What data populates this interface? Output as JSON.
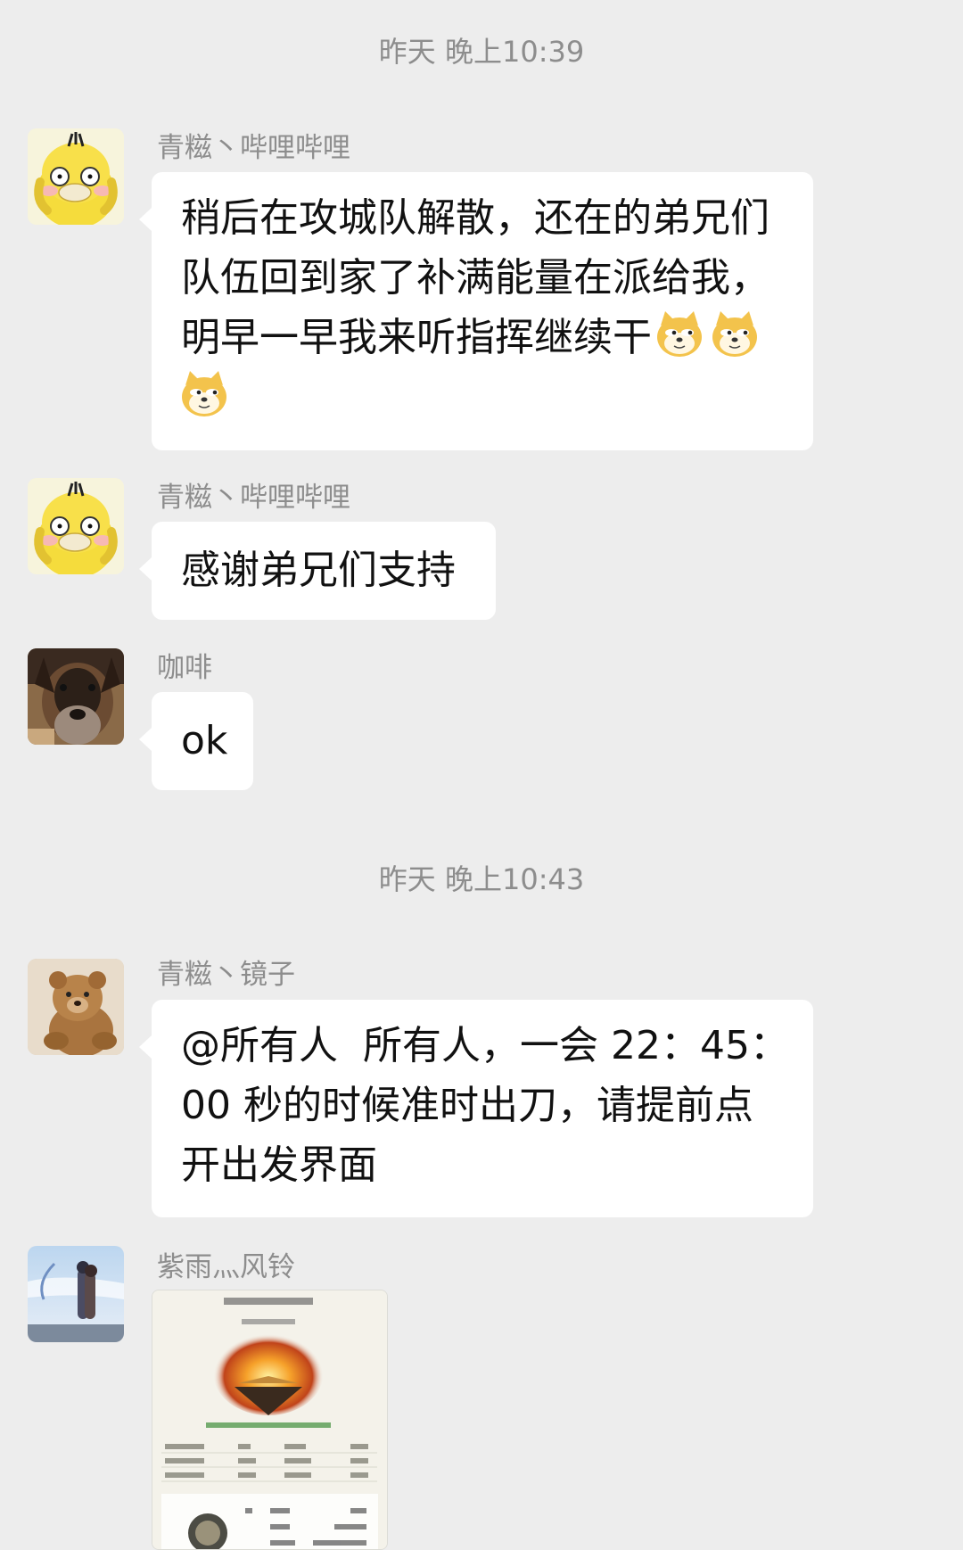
{
  "chat": {
    "timestamps": [
      "昨天 晚上10:39",
      "昨天 晚上10:43"
    ],
    "messages": [
      {
        "sender": "青糍丶哔哩哔哩",
        "avatar": "psyduck-avatar",
        "lines": [
          "稍后在攻城队解散，还在的弟兄们",
          "队伍回到家了补满能量在派给我，",
          "明早一早我来听指挥继续干"
        ],
        "emoji": [
          "doge-emoji",
          "doge-emoji",
          "doge-emoji"
        ]
      },
      {
        "sender": "青糍丶哔哩哔哩",
        "avatar": "psyduck-avatar",
        "text": "感谢弟兄们支持"
      },
      {
        "sender": "咖啡",
        "avatar": "dog-avatar",
        "text": "ok"
      },
      {
        "sender": "青糍丶镜子",
        "avatar": "teddy-bear-avatar",
        "lines": [
          "@所有人  所有人，一会 22：45：",
          "00 秒的时候准时出刀，请提前点",
          "开出发界面"
        ]
      },
      {
        "sender": "紫雨灬风铃",
        "avatar": "anime-couple-avatar",
        "image": "game-screenshot-image"
      }
    ]
  },
  "colors": {
    "background": "#ededed",
    "bubble": "#ffffff",
    "meta_text": "#8d8d8d",
    "message_text": "#111111"
  }
}
